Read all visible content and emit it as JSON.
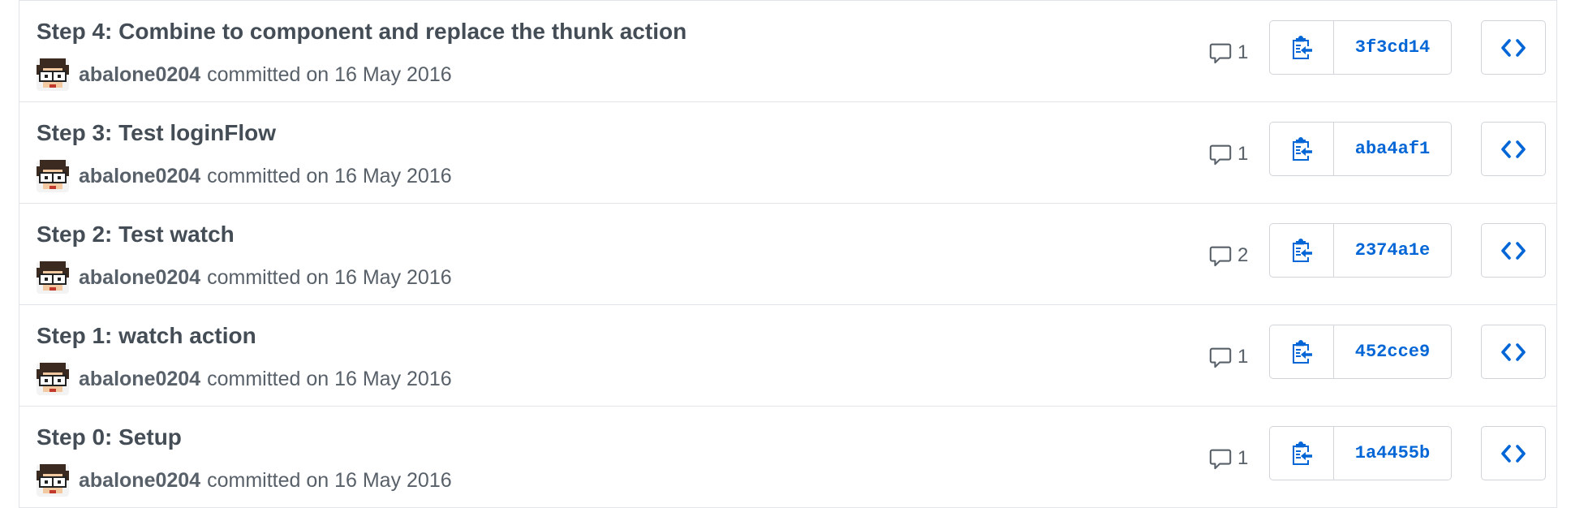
{
  "colors": {
    "link": "#0366d6",
    "title": "#444d56",
    "meta": "#586069",
    "border": "#d1d5da",
    "row_divider": "#e1e4e8"
  },
  "commits": [
    {
      "title": "Step 4: Combine to component and replace the thunk action",
      "author": "abalone0204",
      "date_text": "committed on 16 May 2016",
      "comment_count": "1",
      "sha": "3f3cd14",
      "avatar_icon": "pixel-avatar-icon",
      "comment_icon": "comment-icon",
      "copy_icon": "clippy-icon",
      "browse_icon": "code-icon"
    },
    {
      "title": "Step 3: Test loginFlow",
      "author": "abalone0204",
      "date_text": "committed on 16 May 2016",
      "comment_count": "1",
      "sha": "aba4af1",
      "avatar_icon": "pixel-avatar-icon",
      "comment_icon": "comment-icon",
      "copy_icon": "clippy-icon",
      "browse_icon": "code-icon"
    },
    {
      "title": "Step 2: Test watch",
      "author": "abalone0204",
      "date_text": "committed on 16 May 2016",
      "comment_count": "2",
      "sha": "2374a1e",
      "avatar_icon": "pixel-avatar-icon",
      "comment_icon": "comment-icon",
      "copy_icon": "clippy-icon",
      "browse_icon": "code-icon"
    },
    {
      "title": "Step 1: watch action",
      "author": "abalone0204",
      "date_text": "committed on 16 May 2016",
      "comment_count": "1",
      "sha": "452cce9",
      "avatar_icon": "pixel-avatar-icon",
      "comment_icon": "comment-icon",
      "copy_icon": "clippy-icon",
      "browse_icon": "code-icon"
    },
    {
      "title": "Step 0: Setup",
      "author": "abalone0204",
      "date_text": "committed on 16 May 2016",
      "comment_count": "1",
      "sha": "1a4455b",
      "avatar_icon": "pixel-avatar-icon",
      "comment_icon": "comment-icon",
      "copy_icon": "clippy-icon",
      "browse_icon": "code-icon"
    }
  ]
}
